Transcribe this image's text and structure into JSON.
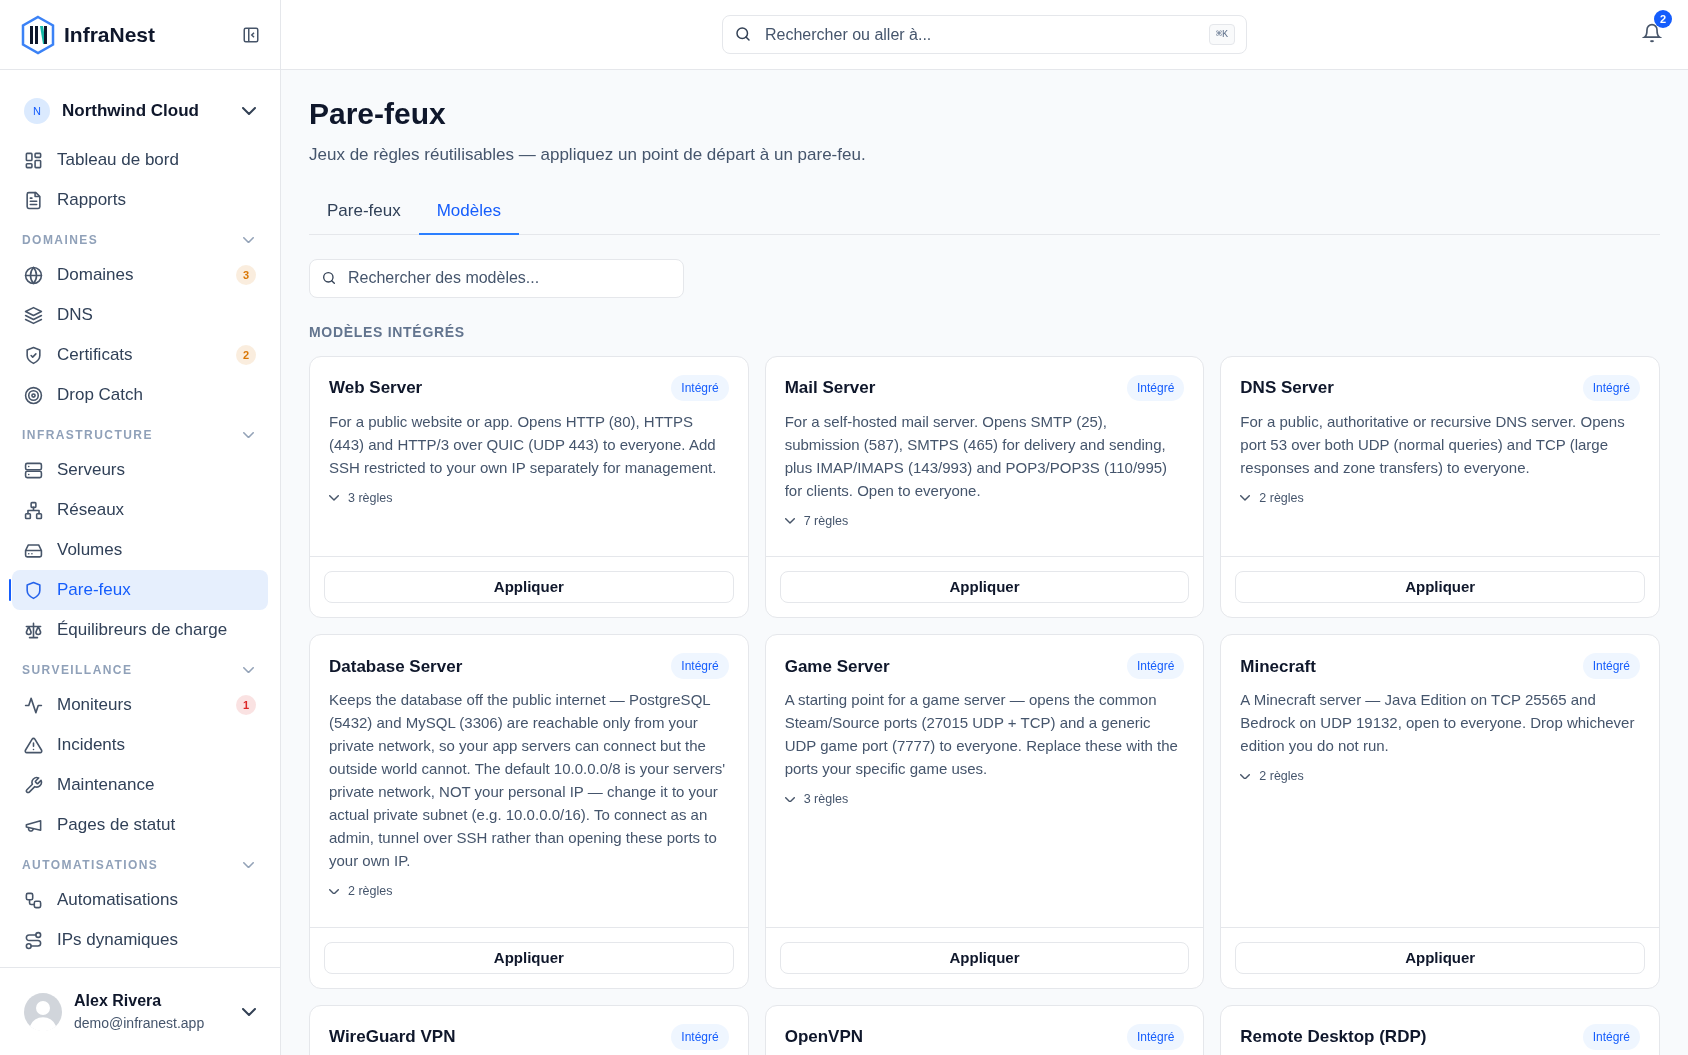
{
  "brand": {
    "name": "InfraNest"
  },
  "workspace": {
    "initial": "N",
    "name": "Northwind Cloud"
  },
  "sidebar": {
    "items": [
      {
        "label": "Tableau de bord",
        "selected": false
      },
      {
        "label": "Rapports",
        "selected": false
      }
    ],
    "groups": [
      {
        "label": "DOMAINES",
        "expanded": true,
        "items": [
          {
            "label": "Domaines",
            "selected": false,
            "badge": {
              "text": "3",
              "color": "#d97706"
            }
          },
          {
            "label": "DNS",
            "selected": false
          },
          {
            "label": "Certificats",
            "selected": false,
            "badge": {
              "text": "2",
              "color": "#d97706"
            }
          },
          {
            "label": "Drop Catch",
            "selected": false
          }
        ]
      },
      {
        "label": "INFRASTRUCTURE",
        "expanded": true,
        "items": [
          {
            "label": "Serveurs",
            "selected": false
          },
          {
            "label": "Réseaux",
            "selected": false
          },
          {
            "label": "Volumes",
            "selected": false
          },
          {
            "label": "Pare-feux",
            "selected": true
          },
          {
            "label": "Équilibreurs de charge",
            "selected": false
          }
        ]
      },
      {
        "label": "SURVEILLANCE",
        "expanded": true,
        "items": [
          {
            "label": "Moniteurs",
            "selected": false,
            "badge": {
              "text": "1",
              "color": "#dc2626"
            }
          },
          {
            "label": "Incidents",
            "selected": false
          },
          {
            "label": "Maintenance",
            "selected": false
          },
          {
            "label": "Pages de statut",
            "selected": false
          }
        ]
      },
      {
        "label": "AUTOMATISATIONS",
        "expanded": true,
        "items": [
          {
            "label": "Automatisations",
            "selected": false
          },
          {
            "label": "IPs dynamiques",
            "selected": false
          }
        ]
      }
    ]
  },
  "user": {
    "name": "Alex Rivera",
    "email": "demo@infranest.app"
  },
  "header": {
    "search": {
      "placeholder": "Rechercher ou aller à...",
      "shortcut": "⌘K"
    },
    "notifications": "2"
  },
  "page": {
    "title": "Pare-feux",
    "subtitle": "Jeux de règles réutilisables — appliquez un point de départ à un pare-feu."
  },
  "tabs": [
    {
      "label": "Pare-feux",
      "selected": false
    },
    {
      "label": "Modèles",
      "selected": true
    }
  ],
  "template_search": {
    "placeholder": "Rechercher des modèles..."
  },
  "section_label": "MODÈLES INTÉGRÉS",
  "templates": [
    {
      "title": "Web Server",
      "badge": "Intégré",
      "description": "For a public website or app. Opens HTTP (80), HTTPS (443) and HTTP/3 over QUIC (UDP 443) to everyone. Add SSH restricted to your own IP separately for management.",
      "rules": "3 règles",
      "expanded": false,
      "button": "Appliquer"
    },
    {
      "title": "Mail Server",
      "badge": "Intégré",
      "description": "For a self-hosted mail server. Opens SMTP (25), submission (587), SMTPS (465) for delivery and sending, plus IMAP/IMAPS (143/993) and POP3/POP3S (110/995) for clients. Open to everyone.",
      "rules": "7 règles",
      "expanded": false,
      "button": "Appliquer"
    },
    {
      "title": "DNS Server",
      "badge": "Intégré",
      "description": "For a public, authoritative or recursive DNS server. Opens port 53 over both UDP (normal queries) and TCP (large responses and zone transfers) to everyone.",
      "rules": "2 règles",
      "expanded": false,
      "button": "Appliquer"
    },
    {
      "title": "Database Server",
      "badge": "Intégré",
      "description": "Keeps the database off the public internet — PostgreSQL (5432) and MySQL (3306) are reachable only from your private network, so your app servers can connect but the outside world cannot. The default 10.0.0.0/8 is your servers' private network, NOT your personal IP — change it to your actual private subnet (e.g. 10.0.0.0/16). To connect as an admin, tunnel over SSH rather than opening these ports to your own IP.",
      "rules": "2 règles",
      "expanded": false,
      "button": "Appliquer"
    },
    {
      "title": "Game Server",
      "badge": "Intégré",
      "description": "A starting point for a game server — opens the common Steam/Source ports (27015 UDP + TCP) and a generic UDP game port (7777) to everyone. Replace these with the ports your specific game uses.",
      "rules": "3 règles",
      "expanded": false,
      "button": "Appliquer"
    },
    {
      "title": "Minecraft",
      "badge": "Intégré",
      "description": "A Minecraft server — Java Edition on TCP 25565 and Bedrock on UDP 19132, open to everyone. Drop whichever edition you do not run.",
      "rules": "2 règles",
      "expanded": false,
      "button": "Appliquer"
    },
    {
      "title": "WireGuard VPN",
      "badge": "Intégré"
    },
    {
      "title": "OpenVPN",
      "badge": "Intégré"
    },
    {
      "title": "Remote Desktop (RDP)",
      "badge": "Intégré"
    }
  ]
}
